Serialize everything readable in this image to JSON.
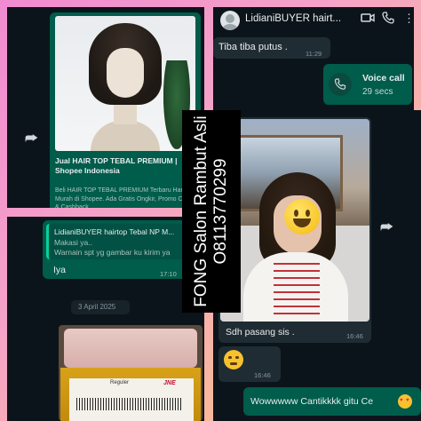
{
  "top_left": {
    "link_title": "Jual HAIR TOP TEBAL PREMIUM | Shopee Indonesia",
    "link_desc": "Beli HAIR TOP TEBAL PREMIUM Terbaru Harga Murah di Shopee. Ada Gratis Ongkir, Promo COD, & Cashback"
  },
  "chat_top": {
    "contact_name": "LidianiBUYER hairt...",
    "msg1": "Tiba tiba putus .",
    "msg1_time": "11:29",
    "call_label": "Voice call",
    "call_duration": "29 secs"
  },
  "chat_mid": {
    "quote_author": "LidianiBUYER hairtop Tebal NP M...",
    "quote_line1": "Makasi ya..",
    "quote_line2": "Warnain spt yg gambar ku kirim ya",
    "reply": "Iya",
    "reply_time": "17:10",
    "date_chip": "3 April 2025",
    "package_label": "JNE",
    "package_reg": "Reguler"
  },
  "chat_right": {
    "photo_caption": "Sdh pasang sis .",
    "photo_time": "16:46",
    "emoji_msg_time": "16:46",
    "last_msg": "Wowwwww Cantikkkk gitu Ce"
  },
  "banner": {
    "line1": "FONG Salon Rambut Asli",
    "line2": "O8113770299"
  },
  "colors": {
    "bubble_out": "#005c4b",
    "bubble_in": "#202c33",
    "chat_bg": "#0b141a",
    "accent": "#25d366"
  },
  "icons": [
    "forward-icon",
    "video-call-icon",
    "phone-icon",
    "more-icon",
    "call-icon",
    "smiley-emoji",
    "teary-emoji",
    "heart-eyes-emoji"
  ]
}
